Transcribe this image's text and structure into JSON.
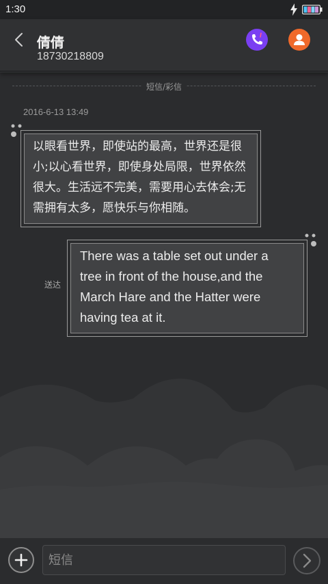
{
  "status_bar": {
    "time": "1:30",
    "icons": [
      "lightning-bolt-icon",
      "battery-icon"
    ]
  },
  "header": {
    "contact_name": "倩倩",
    "contact_number": "18730218809",
    "call_icon": "phone-icon",
    "profile_icon": "person-icon",
    "call_color": "#7a3ff2",
    "profile_color": "#f0692a"
  },
  "conversation": {
    "divider_label": "短信/彩信",
    "timestamp": "2016-6-13 13:49",
    "messages": [
      {
        "direction": "incoming",
        "text": "以眼看世界，即使站的最高，世界还是很小;以心看世界，即使身处局限，世界依然很大。生活远不完美，需要用心去体会;无需拥有太多，愿快乐与你相随。"
      },
      {
        "direction": "outgoing",
        "text": "There was a table set out under a tree in front of the house,and the March Hare and the Hatter were having tea at it.",
        "status": "送达"
      }
    ]
  },
  "composer": {
    "placeholder": "短信",
    "add_icon": "plus-icon",
    "send_icon": "chevron-right-icon"
  }
}
